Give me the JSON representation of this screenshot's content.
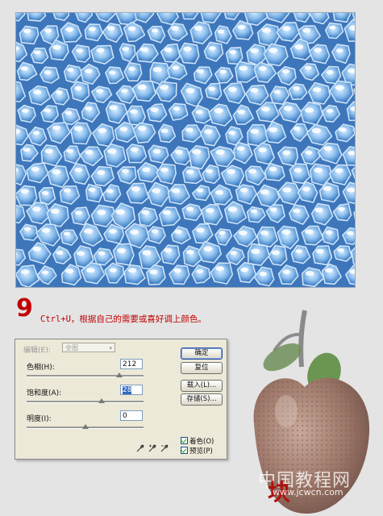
{
  "step": {
    "number": "9",
    "instruction": "Ctrl+U，根据自己的需要或喜好调上颜色。"
  },
  "dialog": {
    "edit_label": "编辑(E):",
    "edit_value": "全图",
    "hue_label": "色相(H):",
    "hue_value": "212",
    "hue_level": 0.79,
    "saturation_label": "饱和度(A):",
    "saturation_value": "28",
    "saturation_level": 0.64,
    "lightness_label": "明度(I):",
    "lightness_value": "0",
    "lightness_level": 0.5,
    "buttons": {
      "ok": "确定",
      "reset": "复位",
      "load": "载入(L)...",
      "save": "存储(S)..."
    },
    "checkboxes": {
      "colorize": "着色(O)",
      "preview": "预览(P)"
    }
  },
  "watermark": {
    "site_cn": "中国教程网",
    "site_url": "www.jcwcn.com",
    "logo": "块"
  },
  "colors": {
    "step_red": "#c00000",
    "bubble_blue": "#3e76bb",
    "dialog_bg": "#ece9d8"
  },
  "icons": {
    "eyedropper_1": "eyedropper-icon",
    "eyedropper_2": "eyedropper-plus-icon",
    "eyedropper_3": "eyedropper-minus-icon"
  }
}
